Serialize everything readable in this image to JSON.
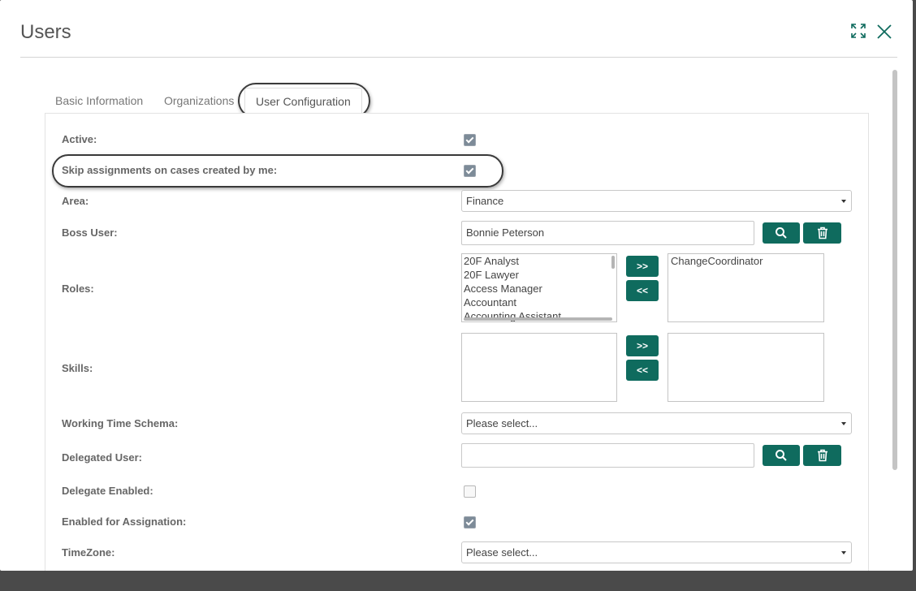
{
  "modal": {
    "title": "Users"
  },
  "tabs": [
    {
      "label": "Basic Information",
      "active": false
    },
    {
      "label": "Organizations",
      "active": false
    },
    {
      "label": "User Configuration",
      "active": true
    }
  ],
  "form": {
    "active": {
      "label": "Active:",
      "checked": true
    },
    "skip_assignments": {
      "label": "Skip assignments on cases created by me:",
      "checked": true
    },
    "area": {
      "label": "Area:",
      "value": "Finance"
    },
    "boss_user": {
      "label": "Boss User:",
      "value": "Bonnie Peterson"
    },
    "roles": {
      "label": "Roles:",
      "available": [
        "20F Analyst",
        "20F Lawyer",
        "Access Manager",
        "Accountant",
        "Accounting Assistant"
      ],
      "selected": [
        "ChangeCoordinator"
      ],
      "add_label": ">>",
      "remove_label": "<<"
    },
    "skills": {
      "label": "Skills:",
      "add_label": ">>",
      "remove_label": "<<"
    },
    "working_time_schema": {
      "label": "Working Time Schema:",
      "value": "Please select..."
    },
    "delegated_user": {
      "label": "Delegated User:",
      "value": ""
    },
    "delegate_enabled": {
      "label": "Delegate Enabled:",
      "checked": false
    },
    "enabled_for_assignation": {
      "label": "Enabled for Assignation:",
      "checked": true
    },
    "timezone": {
      "label": "TimeZone:",
      "value": "Please select..."
    }
  },
  "icons": {
    "expand": "expand-icon",
    "close": "close-icon",
    "search": "search-icon",
    "delete": "trash-icon"
  },
  "colors": {
    "accent": "#0f6b5e",
    "checkbox_checked": "#7d8b98"
  }
}
